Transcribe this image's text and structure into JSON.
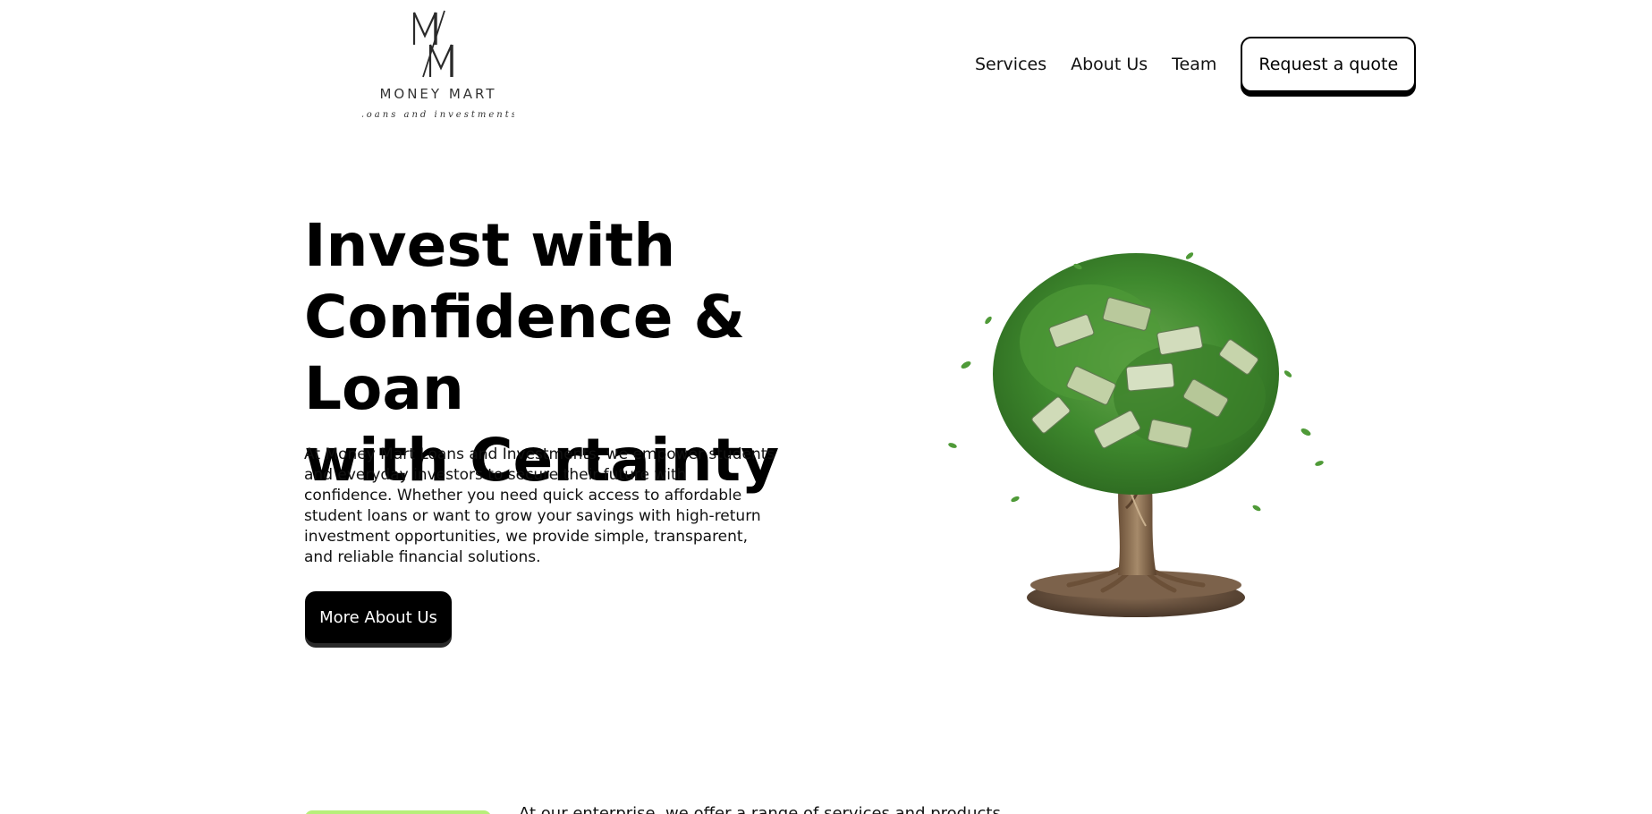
{
  "brand": {
    "monogram": "M/M",
    "name": "MONEY MART",
    "tagline": "Loans and investments"
  },
  "nav": {
    "items": [
      {
        "label": "Services"
      },
      {
        "label": "About Us"
      },
      {
        "label": "Team"
      }
    ],
    "cta_label": "Request a quote"
  },
  "hero": {
    "title_line1": "Invest with",
    "title_line2": "Confidence & Loan",
    "title_line3": "with Certainty",
    "description": "At Money Mart Loans and Investments, we empower students and everyday investors to secure their future with confidence. Whether you need quick access to affordable student loans or want to grow your savings with high-return investment opportunities, we provide simple, transparent, and reliable financial solutions.",
    "button_label": "More About Us",
    "image": "money-tree-illustration"
  },
  "services": {
    "intro": "At our enterprise, we offer a range of services and products"
  },
  "colors": {
    "accent_green": "#b7ef7a",
    "primary": "#000000",
    "background": "#ffffff"
  }
}
